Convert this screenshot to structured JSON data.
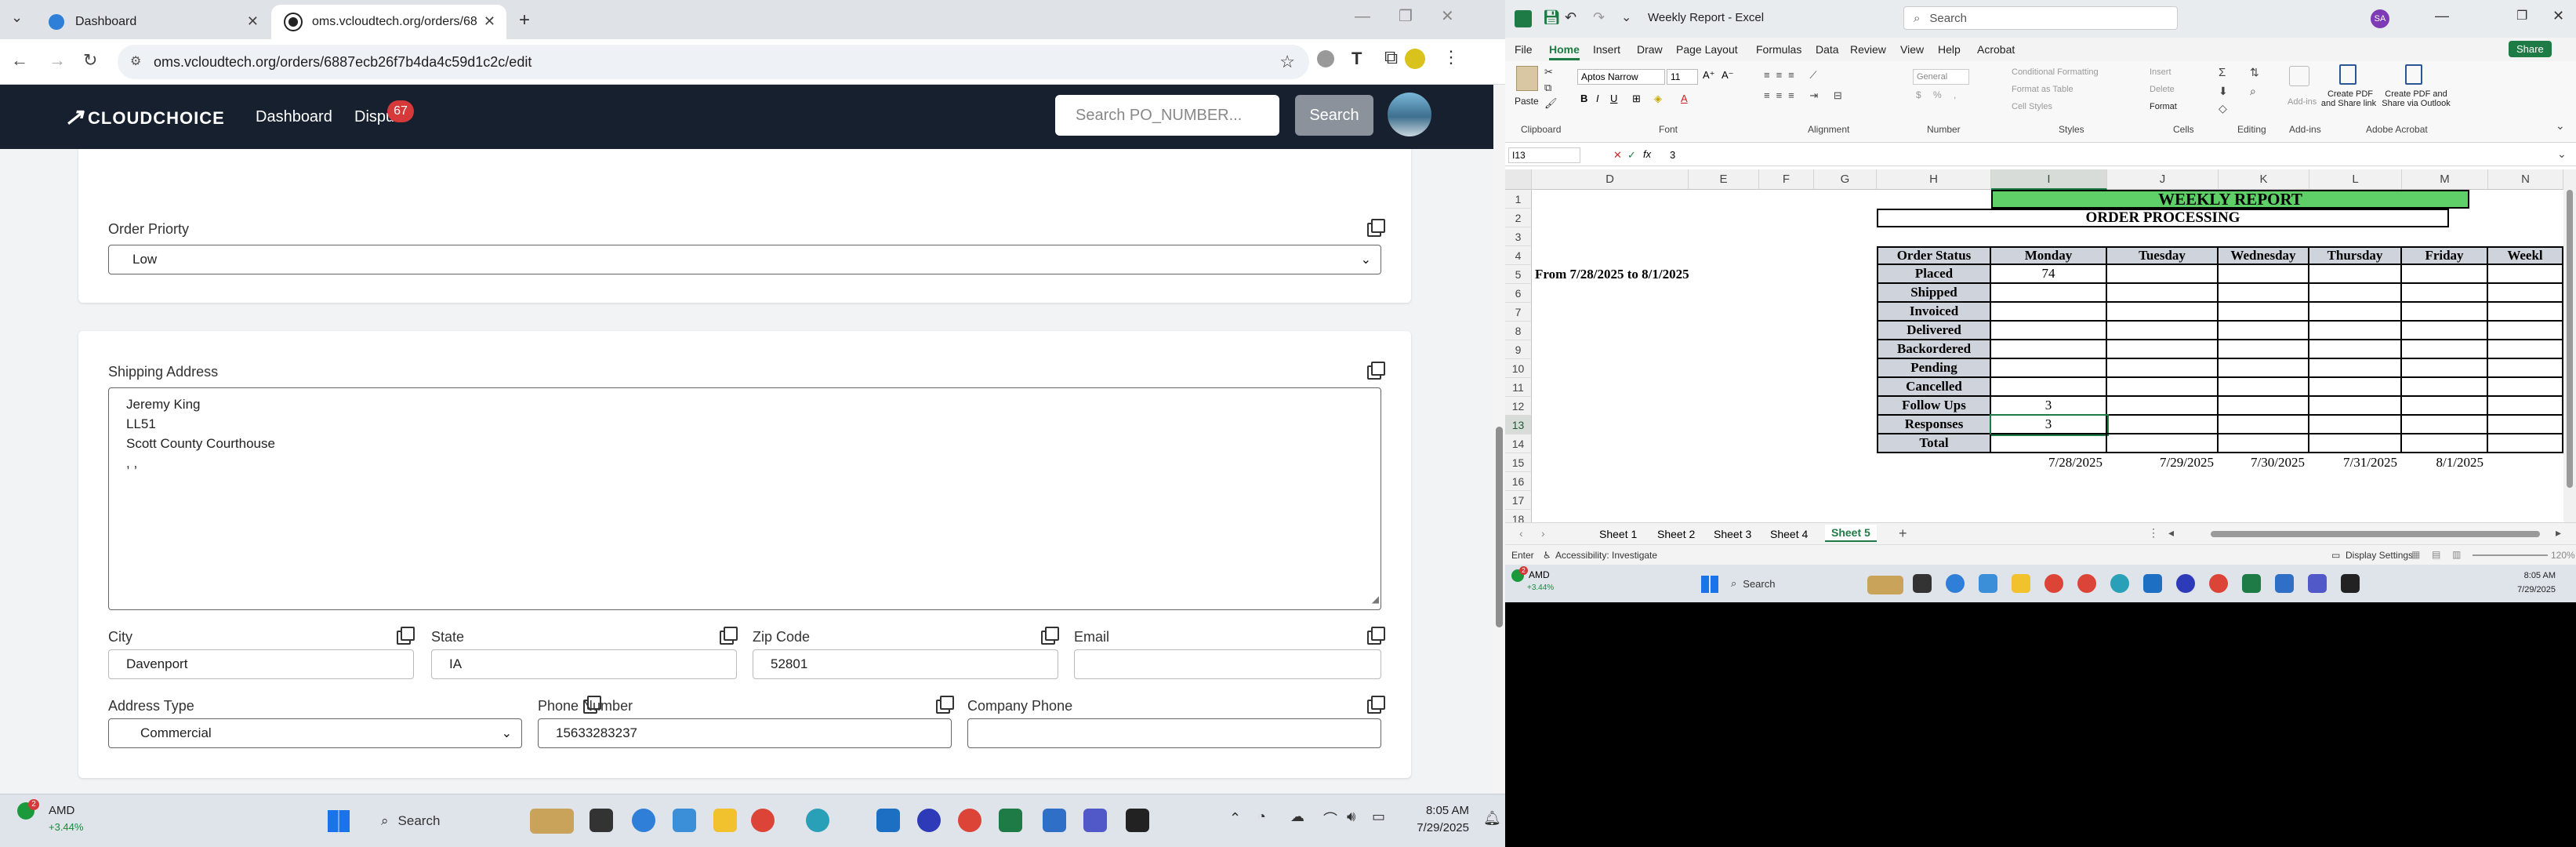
{
  "chrome": {
    "tabs": [
      {
        "title": "Dashboard",
        "active": false
      },
      {
        "title": "oms.vcloudtech.org/orders/68",
        "active": true
      }
    ],
    "url": "oms.vcloudtech.org/orders/6887ecb26f7b4da4c59d1c2c/edit"
  },
  "app": {
    "brand": "CLOUDCHOICE",
    "nav": {
      "dashboard": "Dashboard",
      "disputes": "Dispu",
      "dispute_count": "67"
    },
    "search_placeholder": "Search PO_NUMBER...",
    "search_button": "Search"
  },
  "form": {
    "order_priority_label": "Order Priorty",
    "order_priority_value": "Low",
    "shipping_address_label": "Shipping Address",
    "shipping_address_lines": [
      "Jeremy King",
      "LL51",
      "Scott County Courthouse",
      ", ,"
    ],
    "city_label": "City",
    "city_value": "Davenport",
    "state_label": "State",
    "state_value": "IA",
    "zip_label": "Zip Code",
    "zip_value": "52801",
    "email_label": "Email",
    "email_value": "",
    "address_type_label": "Address Type",
    "address_type_value": "Commercial",
    "phone_label": "Phone Number",
    "phone_value": "15633283237",
    "company_phone_label": "Company Phone",
    "company_phone_value": ""
  },
  "left_taskbar": {
    "stock_name": "AMD",
    "stock_change": "+3.44%",
    "stock_badge": "2",
    "search_label": "Search",
    "time": "8:05 AM",
    "date": "7/29/2025"
  },
  "excel": {
    "title": "Weekly Report - Excel",
    "search_placeholder": "Search",
    "user_initials": "SA",
    "menu": [
      "File",
      "Home",
      "Insert",
      "Draw",
      "Page Layout",
      "Formulas",
      "Data",
      "Review",
      "View",
      "Help",
      "Acrobat"
    ],
    "share": "Share",
    "font_name": "Aptos Narrow",
    "font_size": "11",
    "number_format": "General",
    "ribbon_groups": [
      "Clipboard",
      "Font",
      "Alignment",
      "Number",
      "Styles",
      "Cells",
      "Editing",
      "Add-ins",
      "Adobe Acrobat"
    ],
    "ribbon_buttons": {
      "paste": "Paste",
      "conditional_formatting": "Conditional Formatting",
      "format_as_table": "Format as Table",
      "cell_styles": "Cell Styles",
      "insert": "Insert",
      "delete": "Delete",
      "format": "Format",
      "addins": "Add-ins",
      "pdf_share": [
        "Create PDF",
        "and Share link"
      ],
      "pdf_outlook": [
        "Create PDF and",
        "Share via Outlook"
      ]
    },
    "name_box": "I13",
    "formula_value": "3",
    "fx": "fx",
    "columns": [
      "D",
      "E",
      "F",
      "G",
      "H",
      "I",
      "J",
      "K",
      "L",
      "M",
      "N"
    ],
    "rows": [
      "1",
      "2",
      "3",
      "4",
      "5",
      "6",
      "7",
      "8",
      "9",
      "10",
      "11",
      "12",
      "13",
      "14",
      "15",
      "16",
      "17",
      "18"
    ],
    "report_title": "WEEKLY REPORT",
    "report_subtitle": "ORDER PROCESSING",
    "date_range": "From 7/28/2025 to 8/1/2025",
    "status_header": "Order Status",
    "statuses": [
      "Placed",
      "Shipped",
      "Invoiced",
      "Delivered",
      "Backordered",
      "Pending",
      "Cancelled",
      "Follow Ups",
      "Responses",
      "Total"
    ],
    "days": [
      "Monday",
      "Tuesday",
      "Wednesday",
      "Thursday",
      "Friday",
      "Weekl"
    ],
    "monday_values": [
      "74",
      "",
      "",
      "",
      "",
      "",
      "",
      "3",
      "3",
      ""
    ],
    "dates": [
      "7/28/2025",
      "7/29/2025",
      "7/30/2025",
      "7/31/2025",
      "8/1/2025"
    ],
    "sheets": [
      "Sheet 1",
      "Sheet 2",
      "Sheet 3",
      "Sheet 4",
      "Sheet 5"
    ],
    "active_sheet": "Sheet 5",
    "status_mode": "Enter",
    "accessibility": "Accessibility: Investigate",
    "display_settings": "Display Settings",
    "zoom": "120%"
  },
  "right_taskbar": {
    "stock_name": "AMD",
    "stock_change": "+3.44%",
    "stock_badge": "2",
    "search_label": "Search",
    "time": "8:05 AM",
    "date": "7/29/2025"
  },
  "colors": {
    "nav_bg": "#17202e",
    "badge_red": "#d63939",
    "excel_green": "#3fbb5b",
    "excel_ribbon": "#f8f8f8"
  }
}
